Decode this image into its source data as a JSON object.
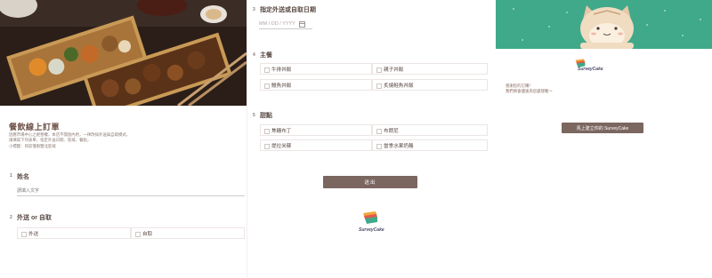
{
  "form": {
    "title": "餐飲線上訂單",
    "description": [
      "因應市場中心之經營權，本店不開放內用，一律改採外送與自取模式，",
      "請填寫下列表單，指定外送日期、區域、餐點，",
      "小標籤：目前僅限雙北區域"
    ]
  },
  "q1": {
    "number": "1",
    "title": "姓名",
    "placeholder": "請填入文字"
  },
  "q2": {
    "number": "2",
    "title": "外送 or 自取",
    "options": [
      "外送",
      "自取"
    ]
  },
  "q3": {
    "number": "3",
    "title": "指定外送或自取日期",
    "placeholder": "MM / DD / YYYY"
  },
  "q4": {
    "number": "4",
    "title": "主餐",
    "options": [
      "牛排丼飯",
      "親子丼飯",
      "鰻魚丼飯",
      "炙燒鮭魚丼飯"
    ]
  },
  "q5": {
    "number": "5",
    "title": "甜點",
    "options": [
      "焦糖布丁",
      "布朗尼",
      "提拉米蘇",
      "當季水果奶酪"
    ]
  },
  "submit_label": "送出",
  "brand_name": "SurveyCake",
  "thankyou": {
    "lines": [
      "感謝您的訂購！",
      "我們將會儘速為您處理喔～"
    ],
    "cta_label": "馬上建立你的 SurveyCake"
  },
  "colors": {
    "brand_brown": "#7b6660",
    "banner_green": "#3fa98a",
    "text": "#5a4a44"
  }
}
